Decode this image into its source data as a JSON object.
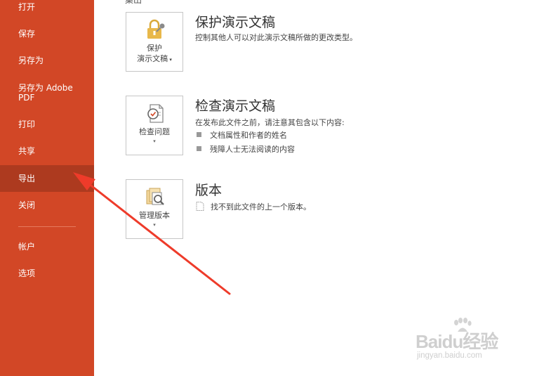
{
  "sidebar": {
    "background": "#d24726",
    "active_background": "#ad3a1f",
    "items": [
      {
        "label": "打开"
      },
      {
        "label": "保存"
      },
      {
        "label": "另存为"
      },
      {
        "label": "另存为 Adobe PDF"
      },
      {
        "label": "打印"
      },
      {
        "label": "共享"
      },
      {
        "label": "导出",
        "selected": true
      },
      {
        "label": "关闭"
      },
      {
        "label": "帐户"
      },
      {
        "label": "选项"
      }
    ]
  },
  "main": {
    "cut_heading": "集出",
    "sections": [
      {
        "tile_label_line1": "保护",
        "tile_label_line2": "演示文稿",
        "tile_icon": "lock-key-icon",
        "title": "保护演示文稿",
        "description": "控制其他人可以对此演示文稿所做的更改类型。"
      },
      {
        "tile_label_line1": "检查问题",
        "tile_icon": "inspect-document-icon",
        "title": "检查演示文稿",
        "description": "在发布此文件之前，请注意其包含以下内容:",
        "bullets": [
          "文档属性和作者的姓名",
          "残障人士无法阅读的内容"
        ]
      },
      {
        "tile_label_line1": "管理版本",
        "tile_icon": "manage-versions-icon",
        "title": "版本",
        "description": "找不到此文件的上一个版本。"
      }
    ]
  },
  "annotation": {
    "color": "#ee3b2a",
    "type": "red-arrow"
  },
  "watermark": {
    "logo": "Baidu经验",
    "url": "jingyan.baidu.com"
  }
}
